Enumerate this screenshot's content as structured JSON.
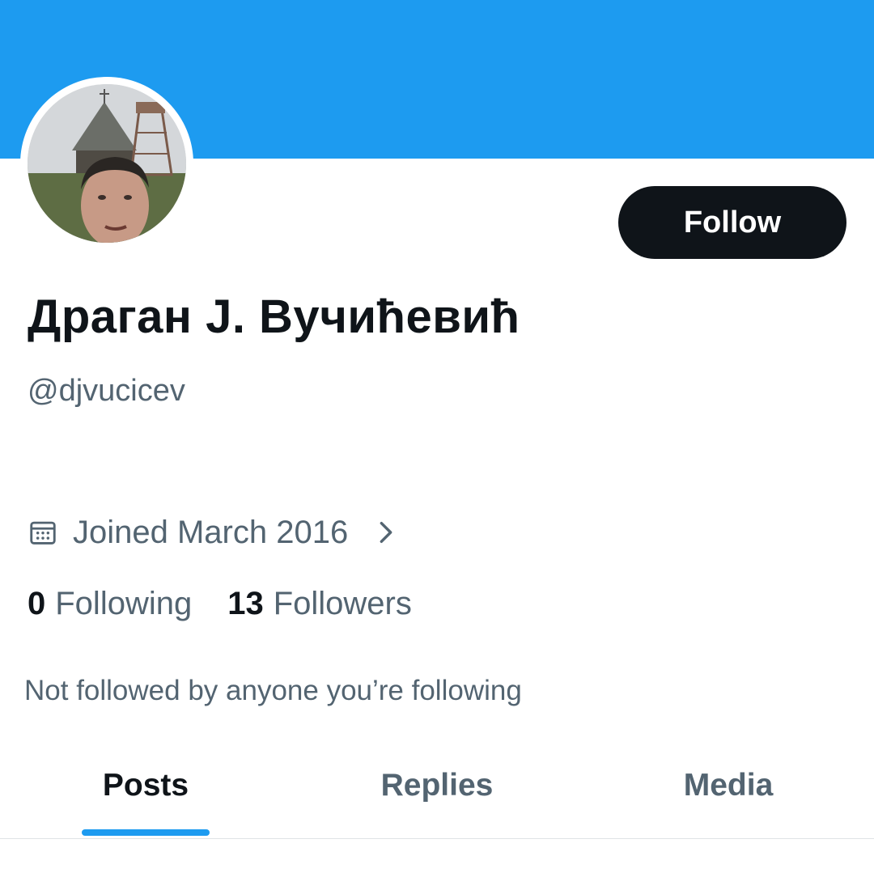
{
  "profile": {
    "display_name": "Драган Ј. Вучићевић",
    "handle": "@djvucicev",
    "joined": "Joined March 2016",
    "following_count": "0",
    "following_label": "Following",
    "followers_count": "13",
    "followers_label": "Followers",
    "followed_by": "Not followed by anyone you’re following"
  },
  "actions": {
    "follow_label": "Follow"
  },
  "tabs": [
    {
      "label": "Posts",
      "active": true
    },
    {
      "label": "Replies",
      "active": false
    },
    {
      "label": "Media",
      "active": false
    }
  ],
  "icons": {
    "joined": "calendar-icon",
    "joined_more": "chevron-right-icon"
  },
  "colors": {
    "banner": "#1d9bf0",
    "button": "#0f1419",
    "secondary_text": "#536471",
    "accent": "#1d9bf0"
  }
}
